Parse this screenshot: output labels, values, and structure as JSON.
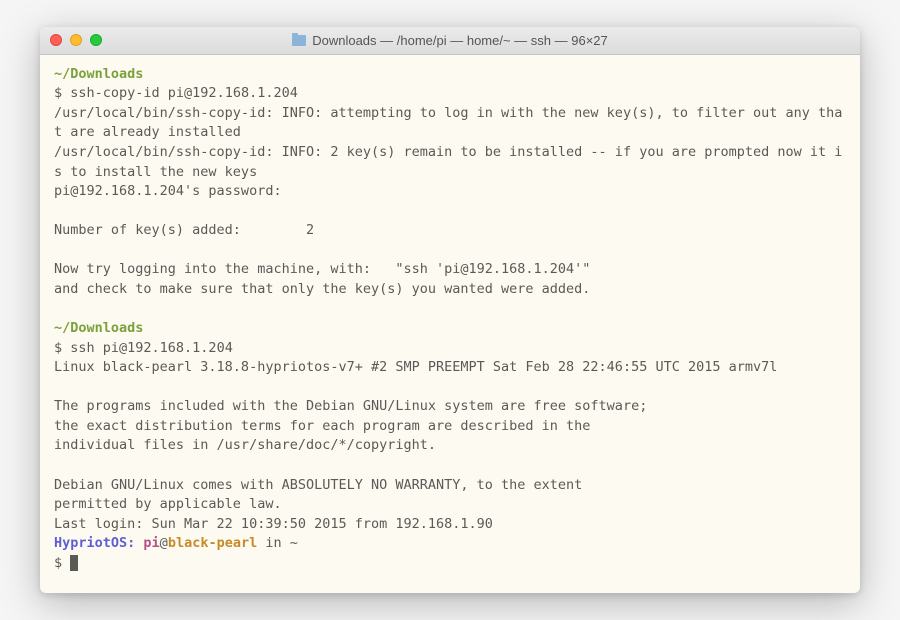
{
  "window": {
    "title": "Downloads — /home/pi — home/~ — ssh — 96×27"
  },
  "session": {
    "cwd1": "~/Downloads",
    "prompt1": "$ ",
    "cmd1": "ssh-copy-id pi@192.168.1.204",
    "out1a": "/usr/local/bin/ssh-copy-id: INFO: attempting to log in with the new key(s), to filter out any that are already installed",
    "out1b": "/usr/local/bin/ssh-copy-id: INFO: 2 key(s) remain to be installed -- if you are prompted now it is to install the new keys",
    "out1c": "pi@192.168.1.204's password:",
    "out1d": "Number of key(s) added:        2",
    "out1e": "Now try logging into the machine, with:   \"ssh 'pi@192.168.1.204'\"",
    "out1f": "and check to make sure that only the key(s) you wanted were added.",
    "cwd2": "~/Downloads",
    "prompt2": "$ ",
    "cmd2": "ssh pi@192.168.1.204",
    "out2a": "Linux black-pearl 3.18.8-hypriotos-v7+ #2 SMP PREEMPT Sat Feb 28 22:46:55 UTC 2015 armv7l",
    "out2b": "The programs included with the Debian GNU/Linux system are free software;",
    "out2c": "the exact distribution terms for each program are described in the",
    "out2d": "individual files in /usr/share/doc/*/copyright.",
    "out2e": "Debian GNU/Linux comes with ABSOLUTELY NO WARRANTY, to the extent",
    "out2f": "permitted by applicable law.",
    "out2g": "Last login: Sun Mar 22 10:39:50 2015 from 192.168.1.90",
    "ps_os": "HypriotOS: ",
    "ps_user": "pi",
    "ps_at": "@",
    "ps_host": "black-pearl",
    "ps_tail": " in ~",
    "prompt3": "$ "
  }
}
